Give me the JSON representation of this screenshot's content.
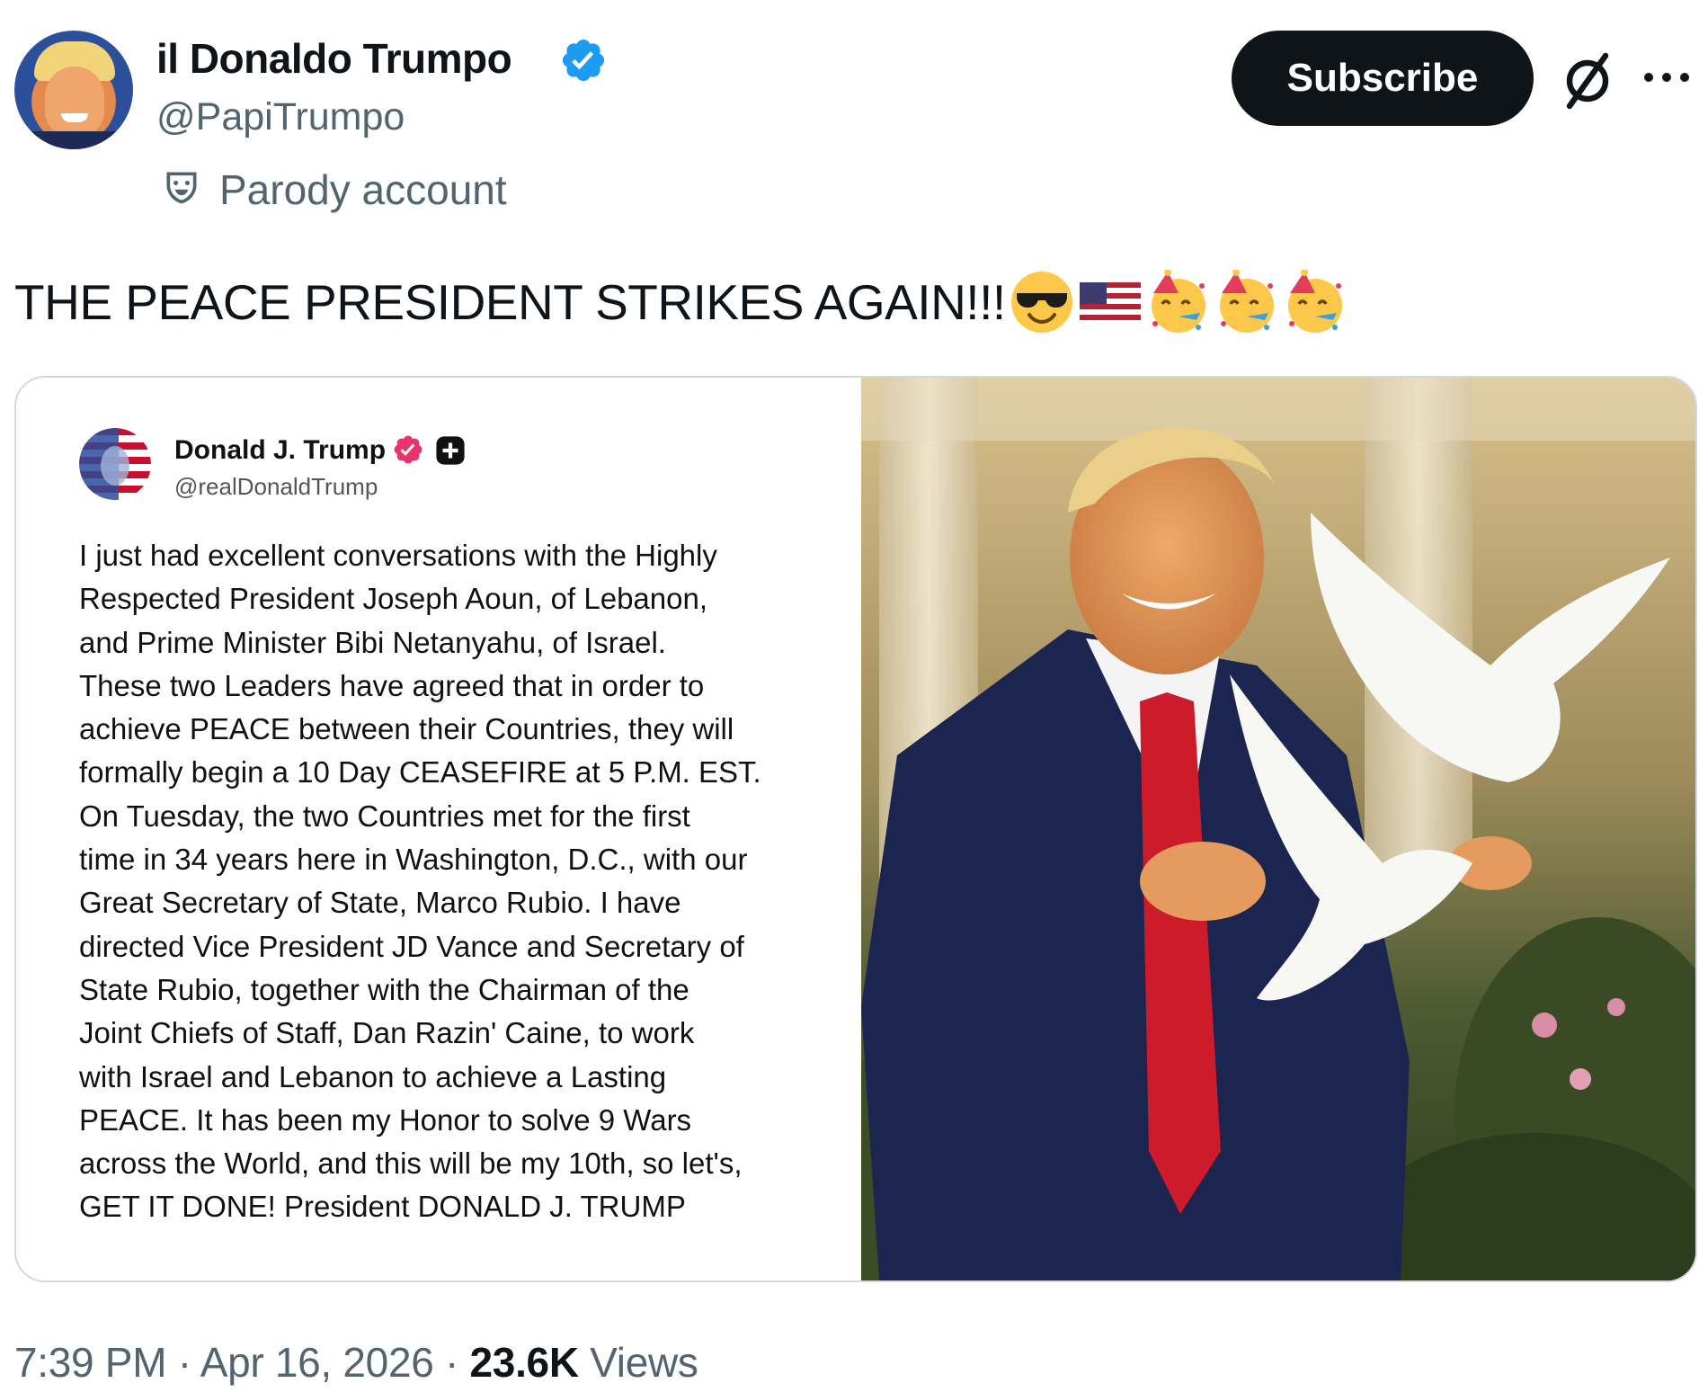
{
  "author": {
    "display_name": "il Donaldo Trumpo",
    "handle": "@PapiTrumpo",
    "label": "Parody account",
    "verified_color": "#1d9bf0"
  },
  "actions": {
    "subscribe_label": "Subscribe",
    "grok_icon": "grok-icon",
    "more_icon": "more-icon"
  },
  "tweet": {
    "text": "THE PEACE PRESIDENT STRIKES AGAIN!!!",
    "emojis": [
      "smiling-face-with-sunglasses",
      "us-flag",
      "partying-face",
      "partying-face",
      "partying-face"
    ]
  },
  "embedded_post": {
    "name": "Donald J. Trump",
    "handle": "@realDonaldTrump",
    "badge_color": "#e8336d",
    "body_lines": [
      "I just had excellent conversations with the Highly",
      "Respected President Joseph Aoun, of Lebanon,",
      "and Prime Minister Bibi Netanyahu, of Israel.",
      "These two Leaders have agreed that in order to",
      "achieve PEACE between their Countries, they will",
      "formally begin a 10 Day CEASEFIRE at 5 P.M. EST.",
      "On Tuesday, the two Countries met for the first",
      "time in 34 years here in Washington, D.C., with our",
      "Great Secretary of State, Marco Rubio. I have",
      "directed Vice President JD Vance and Secretary of",
      "State Rubio, together with the Chairman of the",
      "Joint Chiefs of Staff, Dan Razin' Caine, to work",
      "with Israel and Lebanon to achieve a Lasting",
      "PEACE. It has been my Honor to solve 9 Wars",
      "across the World, and this will be my 10th, so let's,",
      "GET IT DONE! President DONALD J. TRUMP"
    ]
  },
  "footer": {
    "time": "7:39 PM",
    "separator": "·",
    "date": "Apr 16, 2026",
    "views_count": "23.6K",
    "views_label": "Views"
  }
}
